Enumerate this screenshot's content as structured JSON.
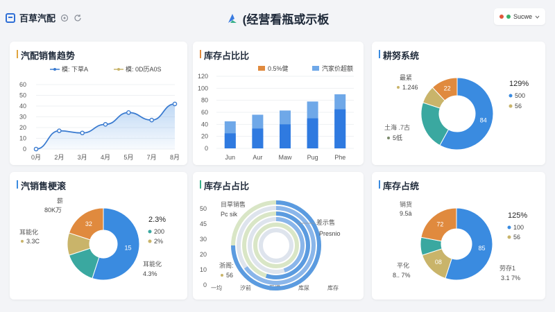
{
  "header": {
    "brand": "百草汽配",
    "title": "(经营看瓶或示板",
    "user": "Sucwe"
  },
  "cards": {
    "c1": {
      "title": "汽配销售趋势",
      "legend": [
        "模: 下草A",
        "模: 0D历A0S"
      ],
      "chart_data": {
        "type": "line",
        "categories": [
          "0月",
          "2月",
          "3月",
          "4月",
          "5月",
          "7月",
          "8月"
        ],
        "series": [
          {
            "name": "模: 下草A",
            "values": [
              0,
              17,
              15,
              23,
              34,
              27,
              42
            ]
          }
        ],
        "ylim": [
          0,
          60
        ],
        "yticks": [
          "60",
          "50",
          "40",
          "30",
          "20",
          "10",
          "0"
        ]
      }
    },
    "c2": {
      "title": "库存占比比",
      "legend": [
        "0.5%健",
        "汽家价超额"
      ],
      "chart_data": {
        "type": "bar",
        "categories": [
          "Jun",
          "Aur",
          "Maw",
          "Pug",
          "Phe"
        ],
        "series": [
          {
            "name": "0.5%健",
            "values": [
              25,
              33,
              40,
              50,
              65
            ]
          },
          {
            "name": "汽家价超额",
            "values": [
              45,
              56,
              63,
              78,
              90
            ]
          }
        ],
        "ylim": [
          0,
          120
        ],
        "yticks": [
          "120",
          "100",
          "80",
          "60",
          "40",
          "20",
          "0"
        ]
      }
    },
    "c3": {
      "title": "耕努系统",
      "labels": {
        "top_left": "最紧",
        "top_left_val": "1.246",
        "bottom_left": "土海 .7古",
        "bottom_left_val": "5低",
        "right_pct": "129%",
        "right_a": "500",
        "right_b": "56"
      },
      "chart_data": {
        "type": "pie",
        "slices": [
          {
            "label": "84",
            "value": 58,
            "color": "#3a8be0"
          },
          {
            "label": "",
            "value": 22,
            "color": "#3aa8a0"
          },
          {
            "label": "",
            "value": 8,
            "color": "#c9b46a"
          },
          {
            "label": "22",
            "value": 12,
            "color": "#e08a3e"
          }
        ]
      }
    },
    "c4": {
      "title": "汽销售梗滚",
      "labels": {
        "top_left": "薪",
        "top_left_val": "80K万",
        "mid_left": "耳能化",
        "mid_left_val": "3.3C",
        "right_pct": "2.3%",
        "right_a": "200",
        "right_b": "2%",
        "bottom_right": "耳能化",
        "bottom_right_val": "4.3%"
      },
      "chart_data": {
        "type": "pie",
        "slices": [
          {
            "label": "15",
            "value": 55,
            "color": "#3a8be0"
          },
          {
            "label": "",
            "value": 15,
            "color": "#3aa8a0"
          },
          {
            "label": "",
            "value": 10,
            "color": "#c9b46a"
          },
          {
            "label": "32",
            "value": 20,
            "color": "#e08a3e"
          }
        ]
      }
    },
    "c5": {
      "title": "库存占占比",
      "labels": {
        "top": "目草销售",
        "top_val": "Pc sik",
        "right": "差示售",
        "right_val": "Presnio",
        "bottom": "浙阁:",
        "bottom_val": "56"
      },
      "yticks": [
        "50",
        "45",
        "30",
        "20",
        "10",
        "0"
      ],
      "xticks": [
        "一均",
        "汐前",
        "互撑",
        "库尿",
        "库存"
      ],
      "chart_data": {
        "type": "pie",
        "rings": [
          0.45,
          0.55,
          0.65,
          0.75
        ]
      }
    },
    "c6": {
      "title": "库存占统",
      "labels": {
        "top_left": "销货",
        "top_left_val": "9.5ä",
        "right_pct": "125%",
        "right_a": "100",
        "right_b": "56",
        "bottom_left": "平化",
        "bottom_left_val": "8.. 7%",
        "bottom_right": "劳存1",
        "bottom_right_val": "3.1 7%"
      },
      "chart_data": {
        "type": "pie",
        "slices": [
          {
            "label": "85",
            "value": 55,
            "color": "#3a8be0"
          },
          {
            "label": "08",
            "value": 15,
            "color": "#c9b46a"
          },
          {
            "label": "",
            "value": 8,
            "color": "#3aa8a0"
          },
          {
            "label": "72",
            "value": 22,
            "color": "#e08a3e"
          }
        ]
      }
    }
  },
  "colors": {
    "blue": "#3a8be0",
    "blue_light": "#6fa8e8",
    "orange": "#e08a3e",
    "teal": "#3aa8a0",
    "olive": "#c9b46a"
  }
}
